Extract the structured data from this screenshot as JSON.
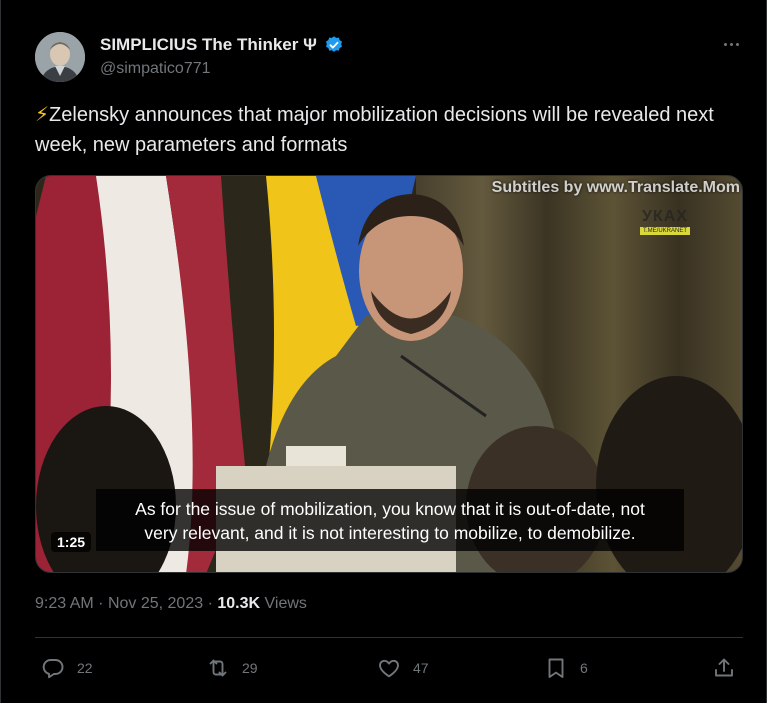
{
  "author": {
    "name": "SIMPLICIUS The Thinker Ψ",
    "handle": "@simpatico771",
    "verified": true,
    "avatar_icon": "avatar-portrait"
  },
  "tweet": {
    "emoji": "⚡",
    "text": "Zelensky announces that major mobilization decisions will be revealed next week, new parameters and formats"
  },
  "media": {
    "watermark": "Subtitles by www.Translate.Mom",
    "channel_logo_text": "УКАХ",
    "channel_logo_subtext": "T.ME/UKRANET",
    "subtitle_line1": "As for the issue of mobilization, you know that it is out-of-date, not",
    "subtitle_line2": "very relevant, and it is not interesting to mobilize, to demobilize.",
    "duration": "1:25"
  },
  "meta": {
    "time": "9:23 AM",
    "separator": "·",
    "date": "Nov 25, 2023",
    "views_count": "10.3K",
    "views_label": "Views"
  },
  "actions": {
    "replies": "22",
    "reposts": "29",
    "likes": "47",
    "bookmarks": "6"
  },
  "colors": {
    "background": "#000000",
    "text_primary": "#e7e9ea",
    "text_secondary": "#71767b",
    "border": "#2f3336",
    "verified": "#1d9bf0"
  }
}
